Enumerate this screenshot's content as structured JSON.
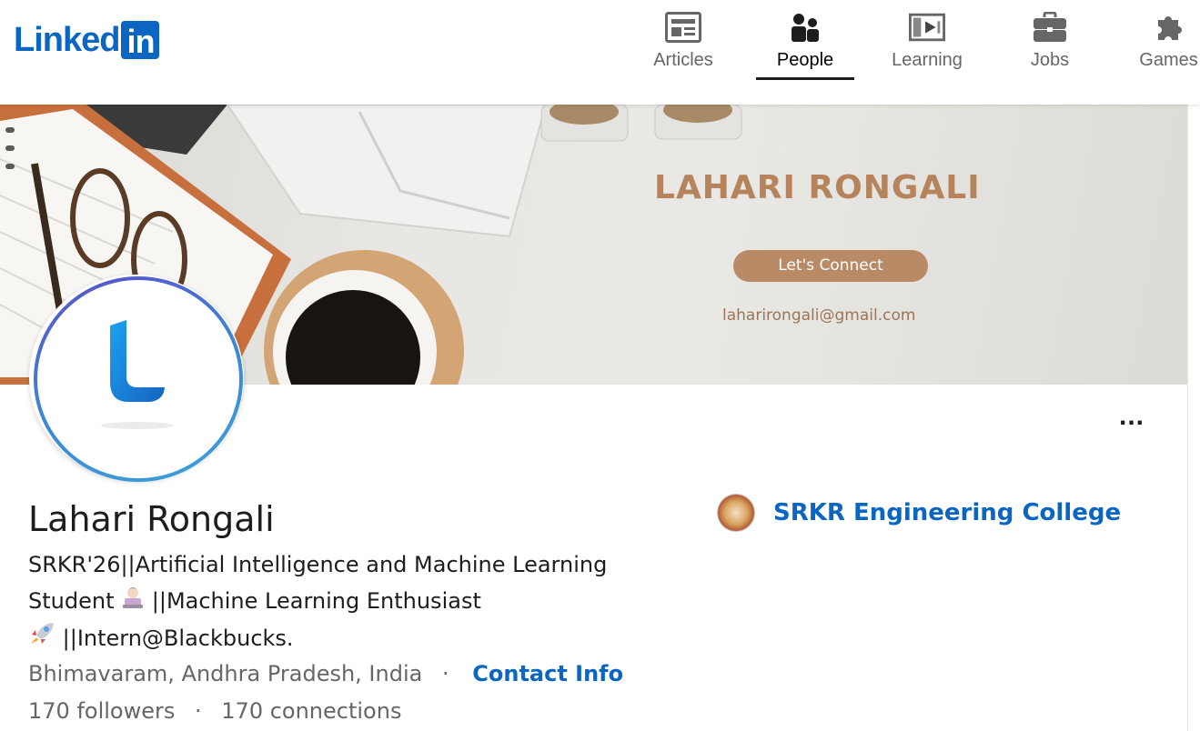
{
  "brand": {
    "logo_text": "Linked",
    "logo_box": "in"
  },
  "nav": {
    "items": [
      {
        "label": "Articles",
        "icon": "articles-icon"
      },
      {
        "label": "People",
        "icon": "people-icon",
        "active": true
      },
      {
        "label": "Learning",
        "icon": "learning-icon"
      },
      {
        "label": "Jobs",
        "icon": "jobs-icon"
      },
      {
        "label": "Games",
        "icon": "games-icon"
      }
    ]
  },
  "banner": {
    "name": "LAHARI RONGALI",
    "button_label": "Let's Connect",
    "email": "laharirongali@gmail.com"
  },
  "profile": {
    "name": "Lahari Rongali",
    "headline_line1": "SRKR'26||Artificial Intelligence and Machine Learning",
    "headline_line2": "Student",
    "headline_line2b": "||Machine Learning Enthusiast",
    "headline_line3": "||Intern@Blackbucks.",
    "location": "Bhimavaram, Andhra Pradesh, India",
    "contact_label": "Contact Info",
    "followers": "170 followers",
    "connections": "170 connections",
    "separator": "·",
    "more_label": "..."
  },
  "education": {
    "school": "SRKR Engineering College"
  },
  "colors": {
    "brand": "#0a66c2",
    "banner_text": "#b5845c",
    "banner_button": "#b88b66"
  }
}
